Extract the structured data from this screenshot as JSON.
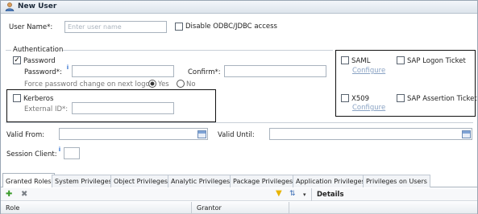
{
  "window": {
    "title": "New User"
  },
  "user": {
    "name_label": "User Name*:",
    "name_placeholder": "Enter user name",
    "disable_odbc_label": "Disable ODBC/JDBC access"
  },
  "authentication": {
    "group_label": "Authentication",
    "password_checkbox_label": "Password",
    "password_checked": true,
    "password_label": "Password*:",
    "confirm_label": "Confirm*:",
    "force_change_label": "Force password change on next logon:",
    "force_yes": "Yes",
    "force_no": "No",
    "force_selected": "Yes",
    "kerberos_label": "Kerberos",
    "external_id_label": "External ID*:",
    "saml_label": "SAML",
    "saml_configure": "Configure",
    "sap_logon_ticket_label": "SAP Logon Ticket",
    "x509_label": "X509",
    "x509_configure": "Configure",
    "sap_assertion_ticket_label": "SAP Assertion Ticket"
  },
  "validity": {
    "valid_from_label": "Valid From:",
    "valid_until_label": "Valid Until:",
    "session_client_label": "Session Client:"
  },
  "tabs": [
    {
      "label": "Granted Roles"
    },
    {
      "label": "System Privileges"
    },
    {
      "label": "Object Privileges"
    },
    {
      "label": "Analytic Privileges"
    },
    {
      "label": "Package Privileges"
    },
    {
      "label": "Application Privileges"
    },
    {
      "label": "Privileges on Users"
    }
  ],
  "toolbar": {
    "details_label": "Details"
  },
  "grid": {
    "columns": [
      {
        "label": "Role"
      },
      {
        "label": "Grantor"
      }
    ]
  },
  "colors": {
    "link": "#8aa3c4",
    "info": "#2f6fcf",
    "add": "#3a9b2a",
    "filter": "#e8b400"
  },
  "icons": [
    "user-icon",
    "info-icon",
    "calendar-icon",
    "add-icon",
    "delete-icon",
    "filter-icon",
    "sort-icon",
    "dropdown-arrow-icon"
  ]
}
